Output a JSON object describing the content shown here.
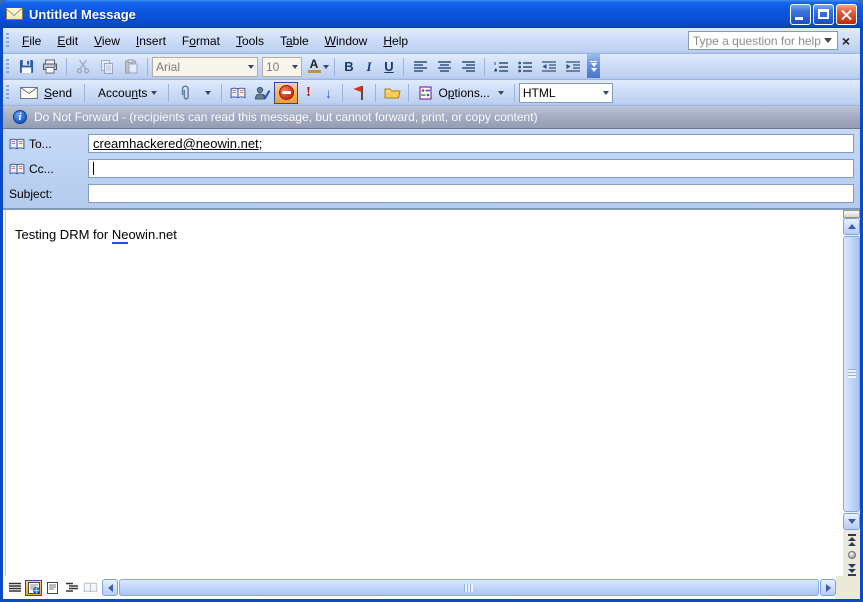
{
  "window": {
    "title": "Untitled Message"
  },
  "menu": {
    "items": [
      {
        "pre": "",
        "key": "F",
        "post": "ile"
      },
      {
        "pre": "",
        "key": "E",
        "post": "dit"
      },
      {
        "pre": "",
        "key": "V",
        "post": "iew"
      },
      {
        "pre": "",
        "key": "I",
        "post": "nsert"
      },
      {
        "pre": "F",
        "key": "o",
        "post": "rmat"
      },
      {
        "pre": "",
        "key": "T",
        "post": "ools"
      },
      {
        "pre": "T",
        "key": "a",
        "post": "ble"
      },
      {
        "pre": "",
        "key": "W",
        "post": "indow"
      },
      {
        "pre": "",
        "key": "H",
        "post": "elp"
      }
    ],
    "question_placeholder": "Type a question for help",
    "close_glyph": "×"
  },
  "format_toolbar": {
    "font_name": "Arial",
    "font_size": "10",
    "bold_glyph": "B",
    "italic_glyph": "I",
    "underline_glyph": "U",
    "font_color_glyph": "A"
  },
  "message_toolbar": {
    "send": {
      "pre": "",
      "key": "S",
      "post": "end"
    },
    "accounts": {
      "pre": "Accou",
      "key": "n",
      "post": "ts"
    },
    "options": {
      "pre": "O",
      "key": "p",
      "post": "tions..."
    },
    "format_value": "HTML",
    "importance_high_glyph": "!",
    "importance_low_glyph": "↓"
  },
  "banner": {
    "text": "Do Not Forward - (recipients can read this message, but cannot forward, print, or copy content)",
    "info_glyph": "i"
  },
  "fields": {
    "to_label": "To...",
    "to_value": "creamhackered@neowin.net",
    "to_suffix": ";",
    "cc_label": "Cc...",
    "cc_value": "",
    "subject_label": "Subject:",
    "subject_value": ""
  },
  "body": {
    "text_pre": "Testing DRM for ",
    "text_marked": "Ne",
    "text_post": "owin.net"
  },
  "icons": {
    "titlebar": "envelope",
    "minimize": "underscore-bar",
    "maximize": "square-outline",
    "close": "x-cross",
    "permission": "no-entry-red-circle",
    "banner_info": "blue-info-circle",
    "to_cc": "open-address-book"
  },
  "colors": {
    "titlebar_blue": "#0b55de",
    "window_border": "#0a49c8",
    "toolbar_top": "#e1ebfc",
    "toolbar_bottom": "#b0c6ea",
    "selected_toggle_bg": "#fcae54",
    "banner_bg": "#a7aec3",
    "field_area_bg": "#bcd2f2",
    "field_border": "#7f9db9",
    "beige": "#ece9d8",
    "spell_mark": "#2b50d8",
    "font_color_bar": "#c39242"
  }
}
